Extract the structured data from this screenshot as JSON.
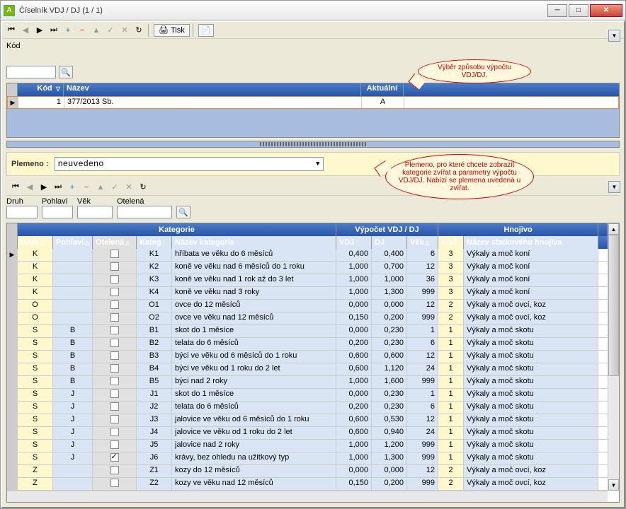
{
  "window": {
    "title": "Číselník VDJ / DJ (1 / 1)"
  },
  "toolbar": {
    "tisk_label": "Tisk"
  },
  "kod": {
    "label": "Kód",
    "value": ""
  },
  "top_grid": {
    "headers": {
      "kod": "Kód",
      "nazev": "Název",
      "aktualni": "Aktuální"
    },
    "row": {
      "kod": "1",
      "nazev": "377/2013 Sb.",
      "aktualni": "A"
    }
  },
  "callout1": "Výběr způsobu výpočtu VDJ/DJ.",
  "plemeno": {
    "label": "Plemeno :",
    "value": "neuvedeno"
  },
  "callout2": "Plemeno, pro které chcete zobrazit kategorie zvířat a parametry výpočtu VDJ/DJ. Nabízí se plemena uvedená u zvířat.",
  "filters": {
    "druh": "Druh",
    "pohlavi": "Pohlaví",
    "vek": "Věk",
    "otelena": "Otelená"
  },
  "bg": {
    "groups": {
      "kategorie": "Kategorie",
      "vypocet": "Výpočet VDJ / DJ",
      "hnojivo": "Hnojivo"
    },
    "headers": {
      "druh": "Druh",
      "pohlavi": "Pohlaví",
      "otelena": "Otelená",
      "kateg": "Kateg",
      "nazev": "Název kategorie",
      "vdj": "VDJ",
      "dj": "DJ",
      "vek": "Věk",
      "hkod": "Kód",
      "hnazev": "Název statkového hnojiva"
    },
    "rows": [
      {
        "druh": "K",
        "pohl": "",
        "otel": false,
        "kateg": "K1",
        "nazev": "hříbata ve věku do 6 měsíců",
        "vdj": "0,400",
        "dj": "0,400",
        "vek": "6",
        "hkod": "3",
        "hnaz": "Výkaly a moč koní"
      },
      {
        "druh": "K",
        "pohl": "",
        "otel": false,
        "kateg": "K2",
        "nazev": "koně ve věku nad 6 měsíců do 1 roku",
        "vdj": "1,000",
        "dj": "0,700",
        "vek": "12",
        "hkod": "3",
        "hnaz": "Výkaly a moč koní"
      },
      {
        "druh": "K",
        "pohl": "",
        "otel": false,
        "kateg": "K3",
        "nazev": "koně ve věku nad 1 rok až do 3 let",
        "vdj": "1,000",
        "dj": "1,000",
        "vek": "36",
        "hkod": "3",
        "hnaz": "Výkaly a moč koní"
      },
      {
        "druh": "K",
        "pohl": "",
        "otel": false,
        "kateg": "K4",
        "nazev": "koně ve věku nad 3 roky",
        "vdj": "1,000",
        "dj": "1,300",
        "vek": "999",
        "hkod": "3",
        "hnaz": "Výkaly a moč koní"
      },
      {
        "druh": "O",
        "pohl": "",
        "otel": false,
        "kateg": "O1",
        "nazev": "ovce do 12 měsíců",
        "vdj": "0,000",
        "dj": "0,000",
        "vek": "12",
        "hkod": "2",
        "hnaz": "Výkaly a moč ovcí, koz"
      },
      {
        "druh": "O",
        "pohl": "",
        "otel": false,
        "kateg": "O2",
        "nazev": "ovce ve věku nad 12 měsíců",
        "vdj": "0,150",
        "dj": "0,200",
        "vek": "999",
        "hkod": "2",
        "hnaz": "Výkaly a moč ovcí, koz"
      },
      {
        "druh": "S",
        "pohl": "B",
        "otel": false,
        "kateg": "B1",
        "nazev": "skot do 1 měsíce",
        "vdj": "0,000",
        "dj": "0,230",
        "vek": "1",
        "hkod": "1",
        "hnaz": "Výkaly a moč skotu"
      },
      {
        "druh": "S",
        "pohl": "B",
        "otel": false,
        "kateg": "B2",
        "nazev": "telata do 6 měsíců",
        "vdj": "0,200",
        "dj": "0,230",
        "vek": "6",
        "hkod": "1",
        "hnaz": "Výkaly a moč skotu"
      },
      {
        "druh": "S",
        "pohl": "B",
        "otel": false,
        "kateg": "B3",
        "nazev": "býci ve věku od 6 měsíců do 1 roku",
        "vdj": "0,600",
        "dj": "0,600",
        "vek": "12",
        "hkod": "1",
        "hnaz": "Výkaly a moč skotu"
      },
      {
        "druh": "S",
        "pohl": "B",
        "otel": false,
        "kateg": "B4",
        "nazev": "býci ve věku od 1 roku do 2 let",
        "vdj": "0,600",
        "dj": "1,120",
        "vek": "24",
        "hkod": "1",
        "hnaz": "Výkaly a moč skotu"
      },
      {
        "druh": "S",
        "pohl": "B",
        "otel": false,
        "kateg": "B5",
        "nazev": "býci nad 2 roky",
        "vdj": "1,000",
        "dj": "1,600",
        "vek": "999",
        "hkod": "1",
        "hnaz": "Výkaly a moč skotu"
      },
      {
        "druh": "S",
        "pohl": "J",
        "otel": false,
        "kateg": "J1",
        "nazev": "skot do 1 měsíce",
        "vdj": "0,000",
        "dj": "0,230",
        "vek": "1",
        "hkod": "1",
        "hnaz": "Výkaly a moč skotu"
      },
      {
        "druh": "S",
        "pohl": "J",
        "otel": false,
        "kateg": "J2",
        "nazev": "telata do 6 měsíců",
        "vdj": "0,200",
        "dj": "0,230",
        "vek": "6",
        "hkod": "1",
        "hnaz": "Výkaly a moč skotu"
      },
      {
        "druh": "S",
        "pohl": "J",
        "otel": false,
        "kateg": "J3",
        "nazev": "jalovice ve věku od 6 měsíců do 1 roku",
        "vdj": "0,600",
        "dj": "0,530",
        "vek": "12",
        "hkod": "1",
        "hnaz": "Výkaly a moč skotu"
      },
      {
        "druh": "S",
        "pohl": "J",
        "otel": false,
        "kateg": "J4",
        "nazev": "jalovice ve věku od 1 roku do 2 let",
        "vdj": "0,600",
        "dj": "0,940",
        "vek": "24",
        "hkod": "1",
        "hnaz": "Výkaly a moč skotu"
      },
      {
        "druh": "S",
        "pohl": "J",
        "otel": false,
        "kateg": "J5",
        "nazev": "jalovice nad 2 roky",
        "vdj": "1,000",
        "dj": "1,200",
        "vek": "999",
        "hkod": "1",
        "hnaz": "Výkaly a moč skotu"
      },
      {
        "druh": "S",
        "pohl": "J",
        "otel": true,
        "kateg": "J6",
        "nazev": "krávy, bez ohledu na užitkový typ",
        "vdj": "1,000",
        "dj": "1,300",
        "vek": "999",
        "hkod": "1",
        "hnaz": "Výkaly a moč skotu"
      },
      {
        "druh": "Z",
        "pohl": "",
        "otel": false,
        "kateg": "Z1",
        "nazev": "kozy do 12 měsíců",
        "vdj": "0,000",
        "dj": "0,000",
        "vek": "12",
        "hkod": "2",
        "hnaz": "Výkaly a moč ovcí, koz"
      },
      {
        "druh": "Z",
        "pohl": "",
        "otel": false,
        "kateg": "Z2",
        "nazev": "kozy ve věku nad 12 měsíců",
        "vdj": "0,150",
        "dj": "0,200",
        "vek": "999",
        "hkod": "2",
        "hnaz": "Výkaly a moč ovcí, koz"
      }
    ]
  }
}
